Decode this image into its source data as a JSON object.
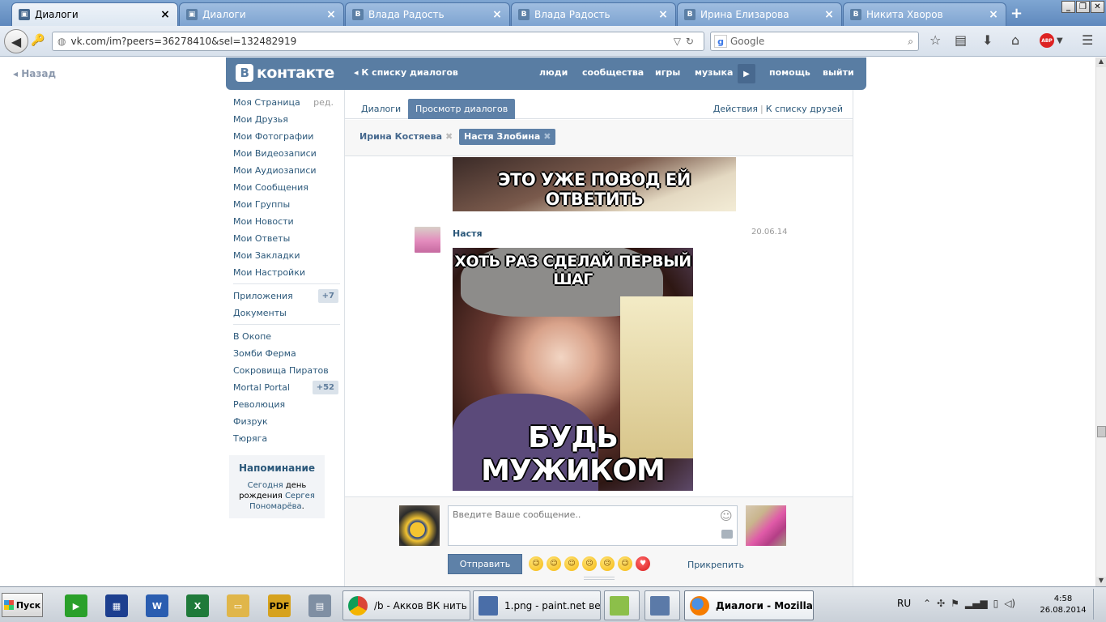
{
  "browser": {
    "tabs": [
      {
        "label": "Диалоги",
        "icon": "vk-dialogs-icon",
        "active": true
      },
      {
        "label": "Диалоги",
        "icon": "vk-dialogs-icon",
        "active": false
      },
      {
        "label": "Влада Радость",
        "icon": "vk-b-icon",
        "active": false
      },
      {
        "label": "Влада Радость",
        "icon": "vk-b-icon",
        "active": false
      },
      {
        "label": "Ирина Елизарова",
        "icon": "vk-b-icon",
        "active": false
      },
      {
        "label": "Никита Хворов",
        "icon": "vk-b-icon",
        "active": false
      }
    ],
    "tab_close": "×",
    "new_tab": "+",
    "window_controls": {
      "minimize": "_",
      "restore": "❐",
      "close": "✕"
    },
    "url": "vk.com/im?peers=36278410&sel=132482919",
    "search_placeholder": "Google",
    "search_engine_letter": "g",
    "adblock_label": "ABP"
  },
  "vk": {
    "back_link": "Назад",
    "logo_letter": "В",
    "logo_text": "контакте",
    "header_dialogs_link": "◂ К списку диалогов",
    "header_links": {
      "people": "люди",
      "communities": "сообщества",
      "games": "игры",
      "music": "музыка",
      "help": "помощь",
      "logout": "выйти"
    },
    "sidebar": {
      "edit_label": "ред.",
      "main": [
        "Моя Страница",
        "Мои Друзья",
        "Мои Фотографии",
        "Мои Видеозаписи",
        "Мои Аудиозаписи",
        "Мои Сообщения",
        "Мои Группы",
        "Мои Новости",
        "Мои Ответы",
        "Мои Закладки",
        "Мои Настройки"
      ],
      "apps_label": "Приложения",
      "apps_badge": "+7",
      "docs_label": "Документы",
      "games": [
        {
          "label": "В Окопе",
          "badge": ""
        },
        {
          "label": "Зомби Ферма",
          "badge": ""
        },
        {
          "label": "Сокровища Пиратов",
          "badge": ""
        },
        {
          "label": "Mortal Portal",
          "badge": "+52"
        },
        {
          "label": "Революция",
          "badge": ""
        },
        {
          "label": "Физрук",
          "badge": ""
        },
        {
          "label": "Тюряга",
          "badge": ""
        }
      ],
      "reminder": {
        "title": "Напоминание",
        "today": "Сегодня",
        "day_word": "день",
        "birthday": "рождения",
        "person": "Сергея Пономарёва",
        "period": "."
      }
    },
    "content_tabs": {
      "dialogs": "Диалоги",
      "view_dialogs": "Просмотр диалогов",
      "actions": "Действия",
      "separator": "|",
      "friends_list": "К списку друзей"
    },
    "peers": [
      {
        "name": "Ирина Костяева",
        "active": false
      },
      {
        "name": "Настя Злобина",
        "active": true
      }
    ],
    "peer_remove": "✖",
    "messages": {
      "meme1_caption": "ЭТО УЖЕ ПОВОД ЕЙ ОТВЕТИТЬ",
      "author": "Настя",
      "date": "20.06.14",
      "meme2_top": "ХОТЬ РАЗ СДЕЛАЙ ПЕРВЫЙ ШАГ",
      "meme2_bottom": "БУДЬ МУЖИКОМ"
    },
    "composer": {
      "placeholder": "Введите Ваше сообщение..",
      "send": "Отправить",
      "attach": "Прикрепить",
      "emojis": [
        "☺",
        "☺",
        "☺",
        "☹",
        "☹",
        "☺",
        "♥"
      ]
    }
  },
  "taskbar": {
    "start": "Пуск",
    "quick_icons": [
      "media-player-icon",
      "save-icon",
      "word-icon",
      "excel-icon",
      "folder-icon",
      "pdf-icon",
      "calculator-icon"
    ],
    "buttons": [
      {
        "label": "/b - Акков ВК нить и...",
        "icon": "chrome-icon",
        "active": false
      },
      {
        "label": "1.png - paint.net вер...",
        "icon": "paintnet-icon",
        "active": false
      },
      {
        "label": "",
        "icon": "notepadpp-icon",
        "active": false
      },
      {
        "label": "",
        "icon": "window-app-icon",
        "active": false
      },
      {
        "label": "Диалоги - Mozilla ...",
        "icon": "firefox-icon",
        "active": true
      }
    ],
    "language": "RU",
    "time": "4:58",
    "date": "26.08.2014"
  }
}
